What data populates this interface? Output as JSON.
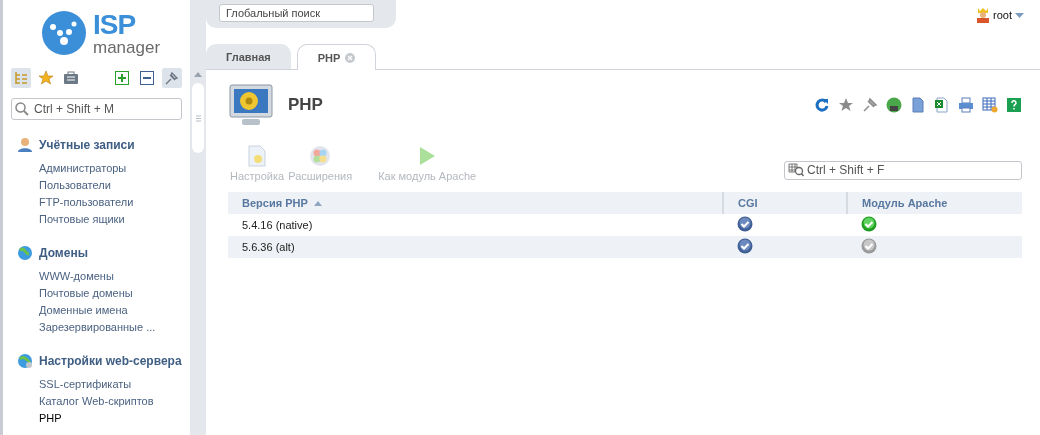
{
  "logo": {
    "brand": "ISP",
    "product": "manager"
  },
  "global_search": {
    "placeholder": "Глобальный поиск"
  },
  "user": {
    "name": "root"
  },
  "sidebar": {
    "search": {
      "placeholder": "Ctrl + Shift + M"
    },
    "sections": [
      {
        "kind": "accounts",
        "title": "Учётные записи",
        "items": [
          {
            "label": "Администраторы",
            "selected": false
          },
          {
            "label": "Пользователи",
            "selected": false
          },
          {
            "label": "FTP-пользователи",
            "selected": false
          },
          {
            "label": "Почтовые ящики",
            "selected": false
          }
        ]
      },
      {
        "kind": "domains",
        "title": "Домены",
        "items": [
          {
            "label": "WWW-домены",
            "selected": false
          },
          {
            "label": "Почтовые домены",
            "selected": false
          },
          {
            "label": "Доменные имена",
            "selected": false
          },
          {
            "label": "Зарезервированные ...",
            "selected": false
          }
        ]
      },
      {
        "kind": "webserver",
        "title": "Настройки web-сервера",
        "items": [
          {
            "label": "SSL-сертификаты",
            "selected": false
          },
          {
            "label": "Каталог Web-скриптов",
            "selected": false
          },
          {
            "label": "PHP",
            "selected": true
          }
        ]
      }
    ]
  },
  "tabs": [
    {
      "label": "Главная",
      "selected": false,
      "closable": false
    },
    {
      "label": "PHP",
      "selected": true,
      "closable": true
    }
  ],
  "page": {
    "title": "PHP",
    "toolbar": [
      {
        "kind": "settings",
        "label": "Настройка",
        "disabled": true
      },
      {
        "kind": "extensions",
        "label": "Расширения",
        "disabled": true
      },
      {
        "kind": "apache",
        "label": "Как модуль Apache",
        "disabled": true
      }
    ],
    "filter": {
      "placeholder": "Ctrl + Shift + F"
    },
    "table": {
      "columns": [
        {
          "label": "Версия PHP",
          "sorted": true
        },
        {
          "label": "CGI",
          "sorted": false
        },
        {
          "label": "Модуль Apache",
          "sorted": false
        }
      ],
      "rows": [
        {
          "version": "5.4.16 (native)",
          "cgi_on": true,
          "apache_on": true
        },
        {
          "version": "5.6.36 (alt)",
          "cgi_on": true,
          "apache_on": false
        }
      ]
    }
  }
}
